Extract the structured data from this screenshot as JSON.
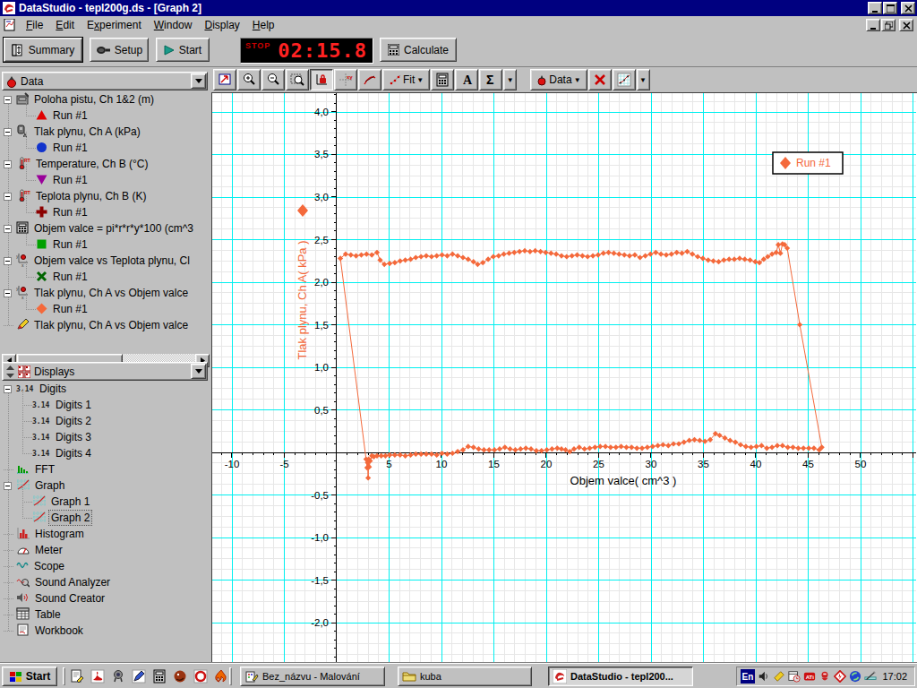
{
  "window": {
    "title": "DataStudio - tepl200g.ds - [Graph 2]"
  },
  "menu": {
    "items": [
      {
        "label": "File",
        "u": 0
      },
      {
        "label": "Edit",
        "u": 0
      },
      {
        "label": "Experiment",
        "u": 1
      },
      {
        "label": "Window",
        "u": 0
      },
      {
        "label": "Display",
        "u": 0
      },
      {
        "label": "Help",
        "u": 0
      }
    ]
  },
  "toolbar": {
    "summary": "Summary",
    "setup": "Setup",
    "start": "Start",
    "timer": {
      "status": "STOP",
      "time": "02:15.8"
    },
    "calculate": "Calculate"
  },
  "graph_toolbar": {
    "buttons": [
      {
        "icon": "scale-to-fit-icon"
      },
      {
        "icon": "zoom-in-icon"
      },
      {
        "icon": "zoom-out-icon"
      },
      {
        "icon": "zoom-select-icon"
      },
      {
        "icon": "smart-tool-icon",
        "pressed": true
      },
      {
        "icon": "xy-tool-icon"
      },
      {
        "icon": "slope-tool-icon"
      },
      {
        "icon": "fit-icon",
        "label": "Fit",
        "arrow": true
      },
      {
        "icon": "calculator-icon"
      },
      {
        "icon": "text-tool-icon"
      },
      {
        "icon": "sigma-icon",
        "splitarrow": true
      },
      {
        "icon": "data-select-icon",
        "label": "Data",
        "arrow": true
      },
      {
        "icon": "delete-icon"
      },
      {
        "icon": "graph-settings-icon",
        "splitarrow": true
      }
    ],
    "fit_label": "Fit",
    "data_label": "Data"
  },
  "data_panel": {
    "title": "Data",
    "groups": [
      {
        "label": "Poloha pistu, Ch 1&2 (m)",
        "icon": "position-sensor-icon",
        "runs": [
          {
            "label": "Run #1",
            "marker": "triangle-up",
            "color": "#e00000"
          }
        ]
      },
      {
        "label": "Tlak plynu, Ch A (kPa)",
        "icon": "pressure-sensor-icon",
        "runs": [
          {
            "label": "Run #1",
            "marker": "circle",
            "color": "#1133cc"
          }
        ]
      },
      {
        "label": "Temperature, Ch B (°C)",
        "icon": "thermometer-icon",
        "runs": [
          {
            "label": "Run #1",
            "marker": "triangle-down",
            "color": "#990099"
          }
        ]
      },
      {
        "label": "Teplota plynu, Ch B (K)",
        "icon": "thermometer-icon",
        "runs": [
          {
            "label": "Run #1",
            "marker": "plus",
            "color": "#8b0000"
          }
        ]
      },
      {
        "label": "Objem valce = pi*r*r*y*100 (cm^3",
        "icon": "calc-data-icon",
        "runs": [
          {
            "label": "Run #1",
            "marker": "square",
            "color": "#00a000"
          }
        ]
      },
      {
        "label": "Objem valce vs Teplota plynu, Cl",
        "icon": "xy-data-icon",
        "runs": [
          {
            "label": "Run #1",
            "marker": "xmark",
            "color": "#006400"
          }
        ]
      },
      {
        "label": "Tlak plynu, Ch A vs Objem valce",
        "icon": "xy-data-icon",
        "runs": [
          {
            "label": "Run #1",
            "marker": "diamond",
            "color": "#f4693b"
          }
        ]
      },
      {
        "label": "Tlak plynu, Ch A vs Objem valce",
        "icon": "pencil-icon",
        "runs": []
      }
    ]
  },
  "displays_panel": {
    "title": "Displays",
    "items": [
      {
        "label": "Digits",
        "icon": "digits-icon",
        "children": [
          {
            "label": "Digits 1"
          },
          {
            "label": "Digits 2"
          },
          {
            "label": "Digits 3"
          },
          {
            "label": "Digits 4"
          }
        ]
      },
      {
        "label": "FFT",
        "icon": "fft-icon"
      },
      {
        "label": "Graph",
        "icon": "graph-icon",
        "children": [
          {
            "label": "Graph 1"
          },
          {
            "label": "Graph 2",
            "selected": true
          }
        ]
      },
      {
        "label": "Histogram",
        "icon": "histogram-icon"
      },
      {
        "label": "Meter",
        "icon": "meter-icon"
      },
      {
        "label": "Scope",
        "icon": "scope-icon"
      },
      {
        "label": "Sound Analyzer",
        "icon": "sound-analyzer-icon"
      },
      {
        "label": "Sound Creator",
        "icon": "sound-creator-icon"
      },
      {
        "label": "Table",
        "icon": "table-icon"
      },
      {
        "label": "Workbook",
        "icon": "workbook-icon"
      }
    ]
  },
  "chart_data": {
    "type": "scatter",
    "title": "",
    "xlabel": "Objem valce( cm^3 )",
    "ylabel": "Tlak plynu, Ch A( kPa )",
    "legend": "Run #1",
    "series_color": "#f4693b",
    "xlim": [
      -11.88,
      55.3
    ],
    "ylim": [
      -2.463,
      4.221
    ],
    "x_major": 5,
    "x_minor": 1,
    "y_major": 0.5,
    "y_minor": 0.125,
    "grid": true,
    "legend_position": "top-right",
    "series": [
      {
        "name": "Run #1",
        "color": "#f4693b",
        "points": [
          [
            0.35,
            2.28
          ],
          [
            0.85,
            2.33
          ],
          [
            1.35,
            2.32
          ],
          [
            1.85,
            2.31
          ],
          [
            2.35,
            2.32
          ],
          [
            2.85,
            2.33
          ],
          [
            3.35,
            2.32
          ],
          [
            3.85,
            2.35
          ],
          [
            4.15,
            2.26
          ],
          [
            4.55,
            2.21
          ],
          [
            5.05,
            2.22
          ],
          [
            5.55,
            2.23
          ],
          [
            6.05,
            2.25
          ],
          [
            6.55,
            2.26
          ],
          [
            7.05,
            2.27
          ],
          [
            7.55,
            2.29
          ],
          [
            8.05,
            2.3
          ],
          [
            8.55,
            2.31
          ],
          [
            9.05,
            2.3
          ],
          [
            9.55,
            2.31
          ],
          [
            10.05,
            2.32
          ],
          [
            10.55,
            2.31
          ],
          [
            11.05,
            2.33
          ],
          [
            11.55,
            2.31
          ],
          [
            12.05,
            2.29
          ],
          [
            12.55,
            2.27
          ],
          [
            13.05,
            2.24
          ],
          [
            13.45,
            2.21
          ],
          [
            13.95,
            2.23
          ],
          [
            14.45,
            2.27
          ],
          [
            14.95,
            2.3
          ],
          [
            15.45,
            2.31
          ],
          [
            15.95,
            2.33
          ],
          [
            16.45,
            2.34
          ],
          [
            16.95,
            2.35
          ],
          [
            17.45,
            2.36
          ],
          [
            17.95,
            2.37
          ],
          [
            18.45,
            2.36
          ],
          [
            18.95,
            2.37
          ],
          [
            19.45,
            2.36
          ],
          [
            19.95,
            2.35
          ],
          [
            20.45,
            2.34
          ],
          [
            20.95,
            2.33
          ],
          [
            21.45,
            2.31
          ],
          [
            21.95,
            2.3
          ],
          [
            22.45,
            2.31
          ],
          [
            22.95,
            2.32
          ],
          [
            23.45,
            2.31
          ],
          [
            23.95,
            2.3
          ],
          [
            24.45,
            2.31
          ],
          [
            24.95,
            2.32
          ],
          [
            25.45,
            2.34
          ],
          [
            25.95,
            2.35
          ],
          [
            26.45,
            2.34
          ],
          [
            26.95,
            2.33
          ],
          [
            27.45,
            2.32
          ],
          [
            27.95,
            2.31
          ],
          [
            28.45,
            2.32
          ],
          [
            28.95,
            2.29
          ],
          [
            29.45,
            2.31
          ],
          [
            29.95,
            2.33
          ],
          [
            30.45,
            2.35
          ],
          [
            30.95,
            2.33
          ],
          [
            31.45,
            2.32
          ],
          [
            31.95,
            2.33
          ],
          [
            32.45,
            2.35
          ],
          [
            32.95,
            2.34
          ],
          [
            33.45,
            2.36
          ],
          [
            33.95,
            2.33
          ],
          [
            34.45,
            2.3
          ],
          [
            34.95,
            2.28
          ],
          [
            35.45,
            2.26
          ],
          [
            35.95,
            2.25
          ],
          [
            36.45,
            2.24
          ],
          [
            36.95,
            2.26
          ],
          [
            37.45,
            2.27
          ],
          [
            37.95,
            2.27
          ],
          [
            38.45,
            2.28
          ],
          [
            38.95,
            2.27
          ],
          [
            39.45,
            2.26
          ],
          [
            39.95,
            2.24
          ],
          [
            40.35,
            2.23
          ],
          [
            40.75,
            2.27
          ],
          [
            41.15,
            2.3
          ],
          [
            41.55,
            2.33
          ],
          [
            41.95,
            2.35
          ],
          [
            42.15,
            2.44
          ],
          [
            42.35,
            2.34
          ],
          [
            42.55,
            2.45
          ],
          [
            42.75,
            2.44
          ],
          [
            43.0,
            2.4
          ],
          [
            44.2,
            1.5
          ],
          [
            46.3,
            0.06
          ],
          [
            46.05,
            0.03
          ],
          [
            45.55,
            0.05
          ],
          [
            45.05,
            0.05
          ],
          [
            44.55,
            0.05
          ],
          [
            44.05,
            0.05
          ],
          [
            43.55,
            0.06
          ],
          [
            43.05,
            0.06
          ],
          [
            42.55,
            0.08
          ],
          [
            42.05,
            0.08
          ],
          [
            41.55,
            0.06
          ],
          [
            41.05,
            0.05
          ],
          [
            40.55,
            0.08
          ],
          [
            40.05,
            0.07
          ],
          [
            39.55,
            0.06
          ],
          [
            39.05,
            0.07
          ],
          [
            38.55,
            0.09
          ],
          [
            38.05,
            0.12
          ],
          [
            37.55,
            0.14
          ],
          [
            37.05,
            0.17
          ],
          [
            36.55,
            0.2
          ],
          [
            36.15,
            0.22
          ],
          [
            35.65,
            0.15
          ],
          [
            35.15,
            0.13
          ],
          [
            34.65,
            0.14
          ],
          [
            34.15,
            0.15
          ],
          [
            33.65,
            0.14
          ],
          [
            33.15,
            0.12
          ],
          [
            32.65,
            0.1
          ],
          [
            32.15,
            0.1
          ],
          [
            31.65,
            0.08
          ],
          [
            31.15,
            0.09
          ],
          [
            30.65,
            0.08
          ],
          [
            30.15,
            0.07
          ],
          [
            29.65,
            0.06
          ],
          [
            29.15,
            0.05
          ],
          [
            28.65,
            0.05
          ],
          [
            28.15,
            0.06
          ],
          [
            27.65,
            0.06
          ],
          [
            27.15,
            0.07
          ],
          [
            26.65,
            0.06
          ],
          [
            26.15,
            0.06
          ],
          [
            25.65,
            0.07
          ],
          [
            25.15,
            0.07
          ],
          [
            24.65,
            0.06
          ],
          [
            24.15,
            0.05
          ],
          [
            23.65,
            0.04
          ],
          [
            23.15,
            0.06
          ],
          [
            22.65,
            0.04
          ],
          [
            22.25,
            0.01
          ],
          [
            21.85,
            0.03
          ],
          [
            21.45,
            0.04
          ],
          [
            21.05,
            0.05
          ],
          [
            20.55,
            0.04
          ],
          [
            20.05,
            0.03
          ],
          [
            19.55,
            0.02
          ],
          [
            19.05,
            0.02
          ],
          [
            18.55,
            0.04
          ],
          [
            18.05,
            0.05
          ],
          [
            17.55,
            0.04
          ],
          [
            17.05,
            0.03
          ],
          [
            16.55,
            0.04
          ],
          [
            16.05,
            0.06
          ],
          [
            15.55,
            0.04
          ],
          [
            15.05,
            0.03
          ],
          [
            14.55,
            0.03
          ],
          [
            14.05,
            0.03
          ],
          [
            13.55,
            0.04
          ],
          [
            13.05,
            0.06
          ],
          [
            12.55,
            0.07
          ],
          [
            12.05,
            0.03
          ],
          [
            11.55,
            0.01
          ],
          [
            11.05,
            -0.01
          ],
          [
            10.55,
            -0.02
          ],
          [
            10.05,
            -0.01
          ],
          [
            9.55,
            -0.03
          ],
          [
            9.05,
            -0.02
          ],
          [
            8.55,
            -0.02
          ],
          [
            8.05,
            -0.02
          ],
          [
            7.55,
            -0.02
          ],
          [
            7.05,
            -0.03
          ],
          [
            6.55,
            -0.04
          ],
          [
            6.05,
            -0.03
          ],
          [
            5.55,
            -0.03
          ],
          [
            5.05,
            -0.03
          ],
          [
            4.65,
            -0.04
          ],
          [
            4.25,
            -0.04
          ],
          [
            3.85,
            -0.04
          ],
          [
            3.55,
            -0.05
          ],
          [
            3.35,
            -0.04
          ],
          [
            3.2,
            -0.1
          ],
          [
            3.1,
            -0.17
          ],
          [
            3.05,
            -0.08
          ],
          [
            3.0,
            -0.3
          ],
          [
            2.95,
            -0.12
          ],
          [
            2.9,
            -0.18
          ],
          [
            2.8,
            -0.08
          ]
        ]
      }
    ]
  },
  "taskbar": {
    "start": "Start",
    "quick_launch": [
      "notepad-icon",
      "acrobat-icon",
      "webcam-icon",
      "pen-tool-icon",
      "calculator-icon",
      "dragon-icon",
      "opera-icon",
      "fire-icon"
    ],
    "windows": [
      {
        "label": "Bez_názvu - Malování",
        "icon": "paint-icon",
        "active": false
      },
      {
        "label": "kuba",
        "icon": "folder-icon",
        "active": false
      },
      {
        "label": "DataStudio - tepl200...",
        "icon": "datastudio-icon",
        "active": true
      }
    ],
    "tray": {
      "lang": "En",
      "time": "17:02",
      "icons": [
        "volume-icon",
        "hotkey-icon",
        "scheduler-icon",
        "ati-icon",
        "creature-icon",
        "winamp-icon",
        "sync-icon",
        "tablet-icon"
      ]
    }
  }
}
